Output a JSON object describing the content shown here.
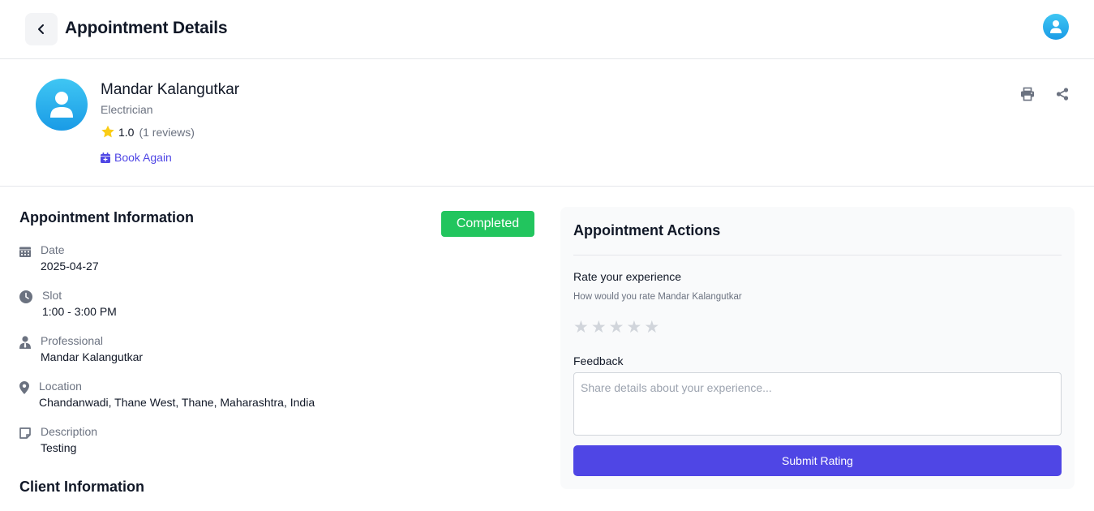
{
  "header": {
    "title": "Appointment Details",
    "back_icon": "chevron-left-icon",
    "avatar_icon": "user-icon"
  },
  "professional": {
    "name": "Mandar Kalangutkar",
    "role": "Electrician",
    "rating": "1.0",
    "reviews": "(1 reviews)",
    "book_again": "Book Again",
    "print_icon": "print-icon",
    "share_icon": "share-icon"
  },
  "appointment": {
    "section_title": "Appointment Information",
    "status": "Completed",
    "date_label": "Date",
    "date_value": "2025-04-27",
    "slot_label": "Slot",
    "slot_value": "1:00 - 3:00 PM",
    "professional_label": "Professional",
    "professional_value": "Mandar Kalangutkar",
    "location_label": "Location",
    "location_value": "Chandanwadi, Thane West, Thane, Maharashtra, India",
    "description_label": "Description",
    "description_value": "Testing"
  },
  "client": {
    "section_title": "Client Information"
  },
  "actions": {
    "title": "Appointment Actions",
    "rate_title": "Rate your experience",
    "rate_subtitle": "How would you rate Mandar Kalangutkar",
    "stars": [
      "★",
      "★",
      "★",
      "★",
      "★"
    ],
    "feedback_label": "Feedback",
    "feedback_value": "",
    "feedback_placeholder": "Share details about your experience...",
    "submit_label": "Submit Rating"
  },
  "colors": {
    "accent": "#4f46e5",
    "status_completed": "#22c55e",
    "avatar_gradient_top": "#3fc6f3",
    "avatar_gradient_bottom": "#1a9be6",
    "star_rated": "#facc15",
    "star_empty": "#d1d5db"
  }
}
